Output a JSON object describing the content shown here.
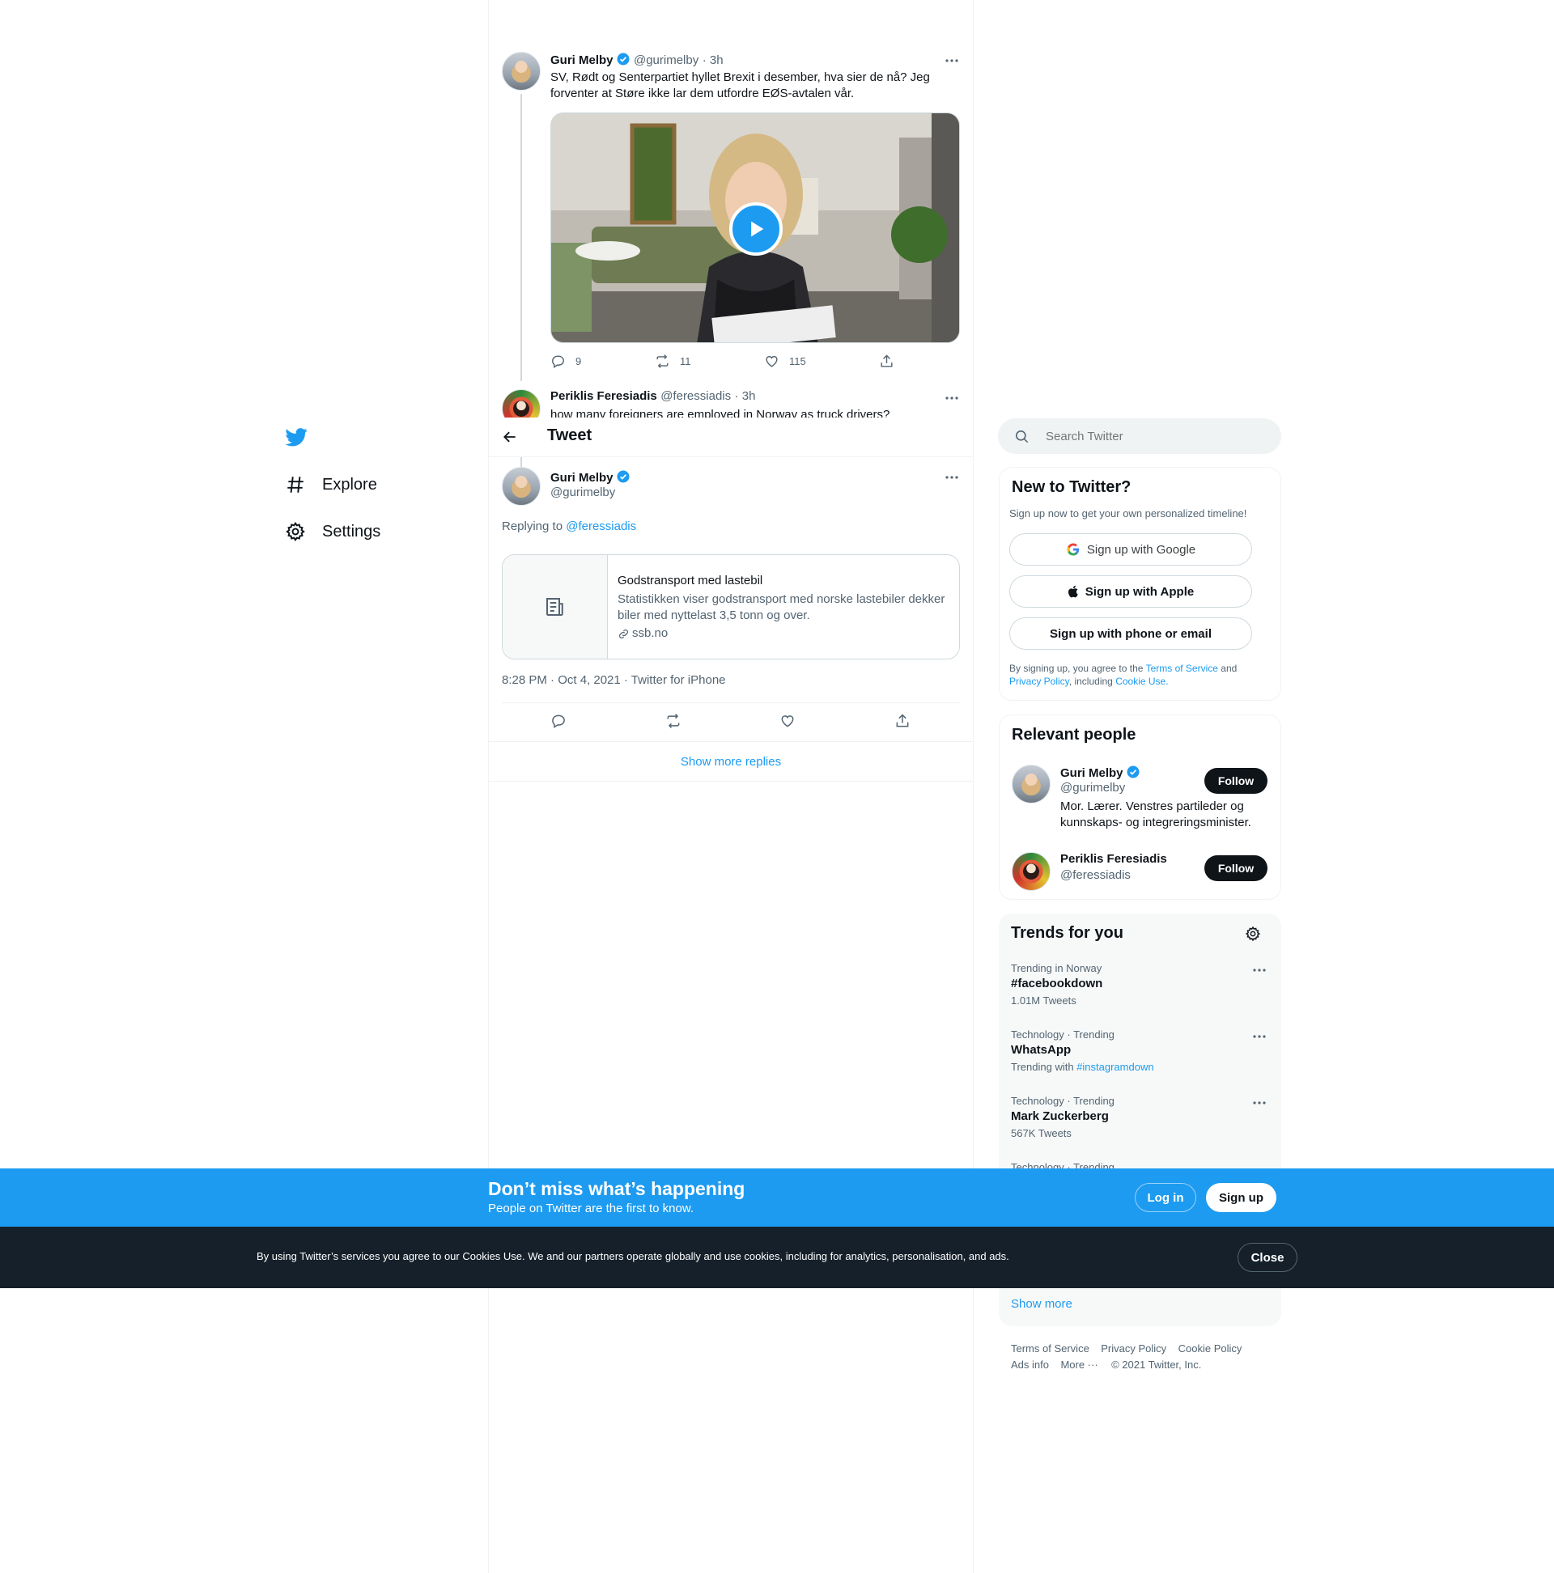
{
  "colors": {
    "accent": "#1d9bf0",
    "text": "#0f1419",
    "muted": "#536471",
    "dark_bar": "#15202b"
  },
  "nav": {
    "logo_icon": "twitter-bird-icon",
    "items": [
      {
        "icon": "hashtag-icon",
        "label": "Explore"
      },
      {
        "icon": "gear-icon",
        "label": "Settings"
      }
    ]
  },
  "header": {
    "title": "Tweet",
    "back_icon": "arrow-left-icon"
  },
  "parent_tweet": {
    "name": "Guri Melby",
    "handle": "@gurimelby",
    "time": "· 3h",
    "text": "SV, Rødt og Senterpartiet hyllet Brexit i desember, hva sier de nå? Jeg forventer at Støre ikke lar dem utfordre EØS-avtalen vår.",
    "actions": {
      "replies": "9",
      "retweets": "11",
      "likes": "115"
    }
  },
  "reply_tweet": {
    "name": "Periklis Feresiadis",
    "handle": "@feressiadis",
    "time": "· 3h",
    "text": "how many foreigners are employed in Norway as truck drivers?"
  },
  "main_tweet": {
    "name": "Guri Melby",
    "handle": "@gurimelby",
    "replying_prefix": "Replying to",
    "replying_handle": "@feressiadis",
    "card": {
      "title": "Godstransport med lastebil",
      "description": "Statistikken viser godstransport med norske lastebiler dekker biler med nyttelast 3,5 tonn og over.",
      "domain": "ssb.no"
    },
    "timestamp": "8:28 PM · Oct 4, 2021 · Twitter for iPhone",
    "show_more": "Show more replies"
  },
  "search": {
    "placeholder": "Search Twitter"
  },
  "new_to_twitter": {
    "title": "New to Twitter?",
    "subtitle": "Sign up now to get your own personalized timeline!",
    "google": "Sign up with Google",
    "apple": "Sign up with Apple",
    "phone": "Sign up with phone or email",
    "legal_1": "By signing up, you agree to the",
    "terms": "Terms of Service",
    "legal_and": "and",
    "privacy": "Privacy Policy",
    "legal_including": ", including",
    "cookie": "Cookie Use."
  },
  "relevant_people": {
    "title": "Relevant people",
    "people": [
      {
        "name": "Guri Melby",
        "handle": "@gurimelby",
        "bio": "Mor. Lærer. Venstres partileder og kunnskaps- og integreringsminister.",
        "follow": "Follow"
      },
      {
        "name": "Periklis Feresiadis",
        "handle": "@feressiadis",
        "follow": "Follow"
      }
    ]
  },
  "trends": {
    "title": "Trends for you",
    "items": [
      {
        "meta": "Trending in Norway",
        "name": "#facebookdown",
        "sub": "1.01M Tweets"
      },
      {
        "meta": "Technology · Trending",
        "name": "WhatsApp",
        "sub_prefix": "Trending with",
        "sub_link": "#instagramdown"
      },
      {
        "meta": "Technology · Trending",
        "name": "Mark Zuckerberg",
        "sub": "567K Tweets"
      },
      {
        "meta": "Technology · Trending"
      }
    ],
    "show_more": "Show more"
  },
  "footer": {
    "links": [
      "Terms of Service",
      "Privacy Policy",
      "Cookie Policy",
      "Ads info",
      "More ···"
    ],
    "copyright": "© 2021 Twitter, Inc."
  },
  "banner": {
    "title": "Don’t miss what’s happening",
    "subtitle": "People on Twitter are the first to know.",
    "login": "Log in",
    "signup": "Sign up"
  },
  "cookie_bar": {
    "text": "By using Twitter’s services you agree to our Cookies Use. We and our partners operate globally and use cookies, including for analytics, personalisation, and ads.",
    "close": "Close"
  }
}
